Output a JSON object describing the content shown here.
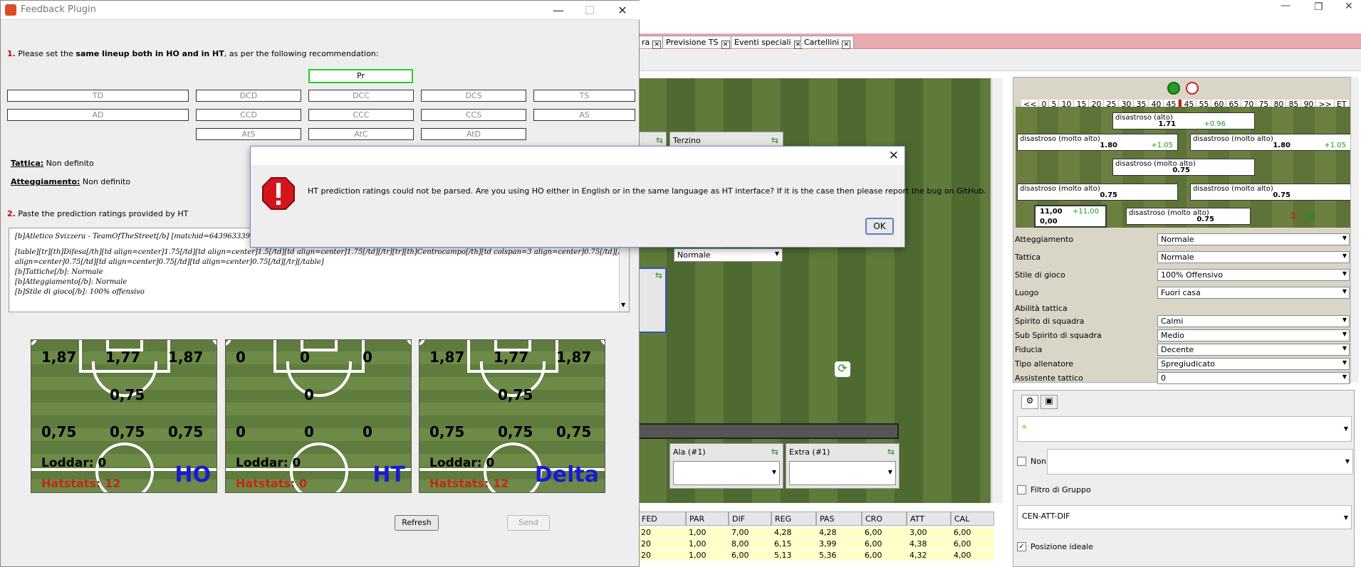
{
  "main_window": {
    "tabs": [
      {
        "label": "ra"
      },
      {
        "label": "Previsione TS"
      },
      {
        "label": "Eventi speciali"
      },
      {
        "label": "Cartellini"
      }
    ],
    "pitch": {
      "labels": {
        "terzino": "Terzino",
        "atteggiamento_value": "Normale",
        "ala": "Ala (#1)",
        "extra": "Extra (#1)"
      }
    },
    "ratings_panel": {
      "scale": [
        "<<",
        "0",
        "5",
        "10",
        "15",
        "20",
        "25",
        "30",
        "35",
        "40",
        "45",
        "45",
        "55",
        "60",
        "65",
        "70",
        "75",
        "80",
        "85",
        "90",
        ">>",
        "ET"
      ],
      "boxes": [
        {
          "label": "disastroso (alto)",
          "value": "1.71",
          "delta": "+0.96"
        },
        {
          "label": "disastroso (molto alto)",
          "value": "1.80",
          "delta": "+1.05"
        },
        {
          "label": "disastroso (molto alto)",
          "value": "1.80",
          "delta": "+1.05"
        },
        {
          "label": "disastroso (molto alto)",
          "value": "0.75",
          "delta": ""
        },
        {
          "label": "disastroso (molto alto)",
          "value": "0.75",
          "delta": ""
        },
        {
          "label": "disastroso (molto alto)",
          "value": "0.75",
          "delta": ""
        },
        {
          "label": "disastroso (molto alto)",
          "value": "0.75",
          "delta": ""
        }
      ],
      "summary": {
        "top": "11,00",
        "top_delta": "+11,00",
        "bottom": "0,00"
      },
      "fields": [
        {
          "label": "Atteggiamento",
          "value": "Normale"
        },
        {
          "label": "Tattica",
          "value": "Normale"
        },
        {
          "label": "Stile di gioco",
          "value": "100% Offensivo"
        },
        {
          "label": "Luogo",
          "value": "Fuori casa"
        },
        {
          "label": "Abilità tattica",
          "value": ""
        },
        {
          "label": "Spirito di squadra",
          "value": "Calmi"
        },
        {
          "label": "Sub Spirito di squadra",
          "value": "Medio"
        },
        {
          "label": "Fiducia",
          "value": "Decente"
        },
        {
          "label": "Tipo allenatore",
          "value": "Spregiudicato"
        },
        {
          "label": "Assistente tattico",
          "value": "0"
        }
      ]
    },
    "lower_panel": {
      "non_label": "Non",
      "group_filter": "Filtro di Gruppo",
      "combo": "CEN-ATT-DIF",
      "ideal_position": "Posizione ideale"
    },
    "table": {
      "headers": [
        "FED",
        "PAR",
        "DIF",
        "REG",
        "PAS",
        "CRO",
        "ATT",
        "CAL"
      ],
      "rows": [
        [
          "20",
          "1,00",
          "7,00",
          "4,28",
          "4,28",
          "6,00",
          "3,00",
          "6,00"
        ],
        [
          "20",
          "1,00",
          "8,00",
          "6,15",
          "3,99",
          "6,00",
          "4,38",
          "6,00"
        ],
        [
          "20",
          "1,00",
          "6,00",
          "5,13",
          "5,36",
          "6,00",
          "4,32",
          "4,00"
        ]
      ]
    }
  },
  "feedback": {
    "title": "Feedback Plugin",
    "step1": {
      "num": "1.",
      "text_a": "Please set the ",
      "text_bold": "same lineup both in HO and in HT",
      "text_b": ", as per the following recommendation:"
    },
    "positions": {
      "gk": "Pr",
      "row1": [
        "TD",
        "DCD",
        "DCC",
        "DCS",
        "TS"
      ],
      "row2": [
        "AD",
        "CCD",
        "CCC",
        "CCS",
        "AS"
      ],
      "row3": [
        "AtS",
        "AtC",
        "AtD"
      ]
    },
    "tattica_label": "Tattica:",
    "tattica_value": "Non definito",
    "atteggiamento_label": "Atteggiamento:",
    "atteggiamento_value": "Non definito",
    "step2": {
      "num": "2.",
      "text": "Paste the prediction ratings provided by HT"
    },
    "pasted_text": [
      "[b]Atletico Svizzera - TeamOfTheStreet[/b]  [matchid=643963339]",
      "",
      "[table][tr][th]Difesa[/th][td align=center]1.75[/td][td align=center]1.5[/td][td align=center]1.75[/td][/tr][tr][th]Centrocampo[/th][td colspan=3 align=center]0.75[/td][/tr][tr][th]Attacco[/th][td",
      "align=center]0.75[/td][td align=center]0.75[/td][td align=center]0.75[/td][/tr][/table]",
      "[b]Tattiche[/b]: Normale",
      "[b]Atteggiamento[/b]: Normale",
      "[b]Stile di gioco[/b]: 100% offensivo"
    ],
    "pitches": [
      {
        "def": [
          "1,87",
          "1,77",
          "1,87"
        ],
        "mid": "0,75",
        "att": [
          "0,75",
          "0,75",
          "0,75"
        ],
        "loddar": "Loddar: 0",
        "hatstats": "Hatstats: 12",
        "label": "HO"
      },
      {
        "def": [
          "0",
          "0",
          "0"
        ],
        "mid": "0",
        "att": [
          "0",
          "0",
          "0"
        ],
        "loddar": "Loddar: 0",
        "hatstats": "Hatstats: 0",
        "label": "HT"
      },
      {
        "def": [
          "1,87",
          "1,77",
          "1,87"
        ],
        "mid": "0,75",
        "att": [
          "0,75",
          "0,75",
          "0,75"
        ],
        "loddar": "Loddar: 0",
        "hatstats": "Hatstats: 12",
        "label": "Delta"
      }
    ],
    "refresh_label": "Refresh",
    "send_label": "Send"
  },
  "dialog": {
    "message": "HT prediction ratings could not be parsed. Are you using HO either in English or in the same language as HT interface? If it is the case then please report the bug on GitHub.",
    "ok_label": "OK"
  }
}
